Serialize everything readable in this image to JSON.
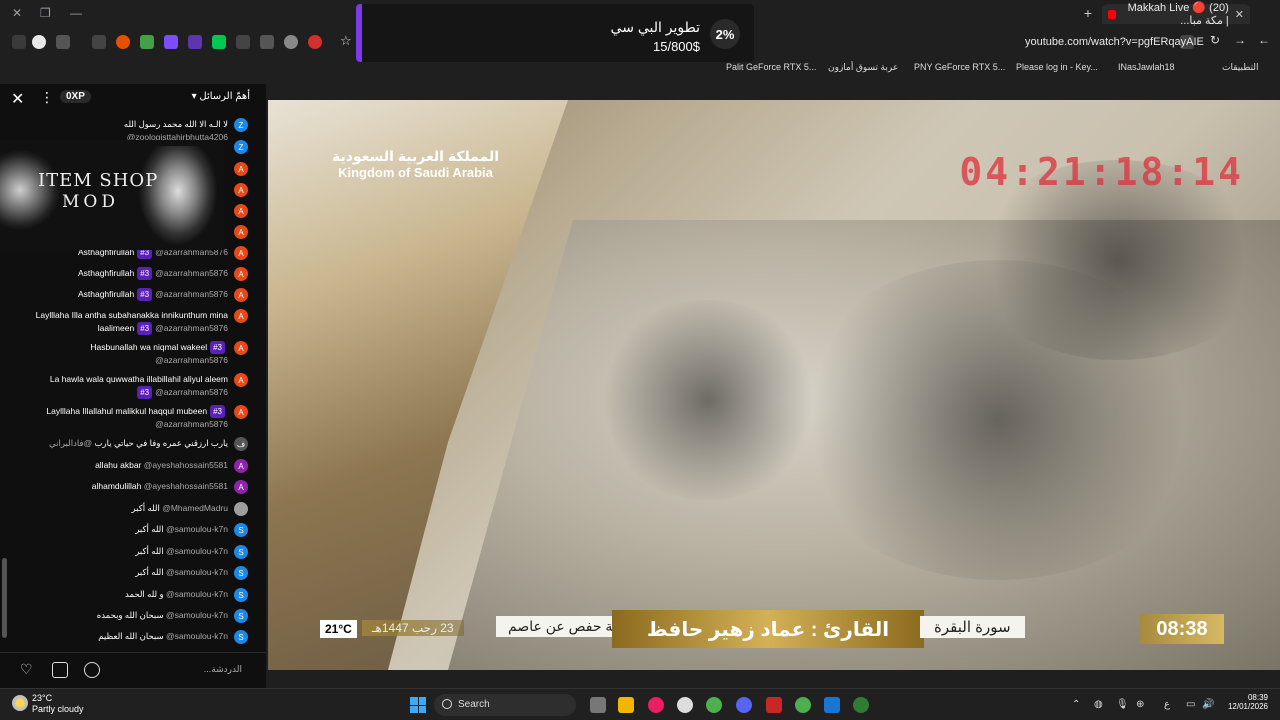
{
  "browser": {
    "tab_title": "(20) 🔴 Makkah Live | مكة مبا...",
    "url": "youtube.com/watch?v=pgfERqayAIE",
    "bookmarks": [
      "Palit GeForce RTX 5...",
      "عربة تسوق أمازون",
      "PNY GeForce RTX 5...",
      "Please log in - Key...",
      "INasJawlah18",
      "التطبيقات"
    ]
  },
  "notification": {
    "title": "تطوير البي سي",
    "progress_text": "15/800$",
    "percent": "2%"
  },
  "chat": {
    "sort_label": "أهمّ الرسائل",
    "xp_label": "0XP",
    "input_placeholder": "الدردشة...",
    "banner": {
      "title": "ITEM SHOP",
      "subtitle": "MOD"
    },
    "messages": [
      {
        "avatar": "Z",
        "color": "#1e88e5",
        "author": "@zoologisttahirbhutta4206",
        "text": "لا الـه الا الله محمد رسول الله"
      },
      {
        "avatar": "Z",
        "color": "#1e88e5",
        "author": "",
        "text": ""
      },
      {
        "avatar": "A",
        "color": "#e64a19",
        "author": "",
        "text": ""
      },
      {
        "avatar": "A",
        "color": "#e64a19",
        "author": "",
        "text": ""
      },
      {
        "avatar": "A",
        "color": "#e64a19",
        "author": "",
        "text": ""
      },
      {
        "avatar": "A",
        "color": "#e64a19",
        "author": "",
        "text": ""
      },
      {
        "avatar": "A",
        "color": "#e64a19",
        "author": "@azarrahman5876",
        "badge": "#3",
        "text": "Asthaghfirullah"
      },
      {
        "avatar": "A",
        "color": "#e64a19",
        "author": "@azarrahman5876",
        "badge": "#3",
        "text": "Asthaghfirullah"
      },
      {
        "avatar": "A",
        "color": "#e64a19",
        "author": "@azarrahman5876",
        "badge": "#3",
        "text": "Asthaghfirullah"
      },
      {
        "avatar": "A",
        "color": "#e64a19",
        "author": "@azarrahman5876",
        "badge": "#3",
        "text": "Laylllaha Illa antha subahanakka innikunthum mina laalimeen"
      },
      {
        "avatar": "A",
        "color": "#e64a19",
        "author": "@azarrahman5876",
        "badge": "#3",
        "text": "Hasbunallah wa niqmal wakeel"
      },
      {
        "avatar": "A",
        "color": "#e64a19",
        "author": "@azarrahman5876",
        "badge": "#3",
        "text": "La hawla wala quwwatha illabillahil aliyul aleem"
      },
      {
        "avatar": "A",
        "color": "#e64a19",
        "author": "@azarrahman5876",
        "badge": "#3",
        "text": "Laylllaha Illallahul malikkul haqqul mubeen"
      },
      {
        "avatar": "ف",
        "color": "#555555",
        "author": "@فادالبراني",
        "text": "يارب ارزقني عمره وفا في حياتي يارب"
      },
      {
        "avatar": "A",
        "color": "#8e24aa",
        "author": "@ayeshahossain5581",
        "text": "allahu akbar"
      },
      {
        "avatar": "A",
        "color": "#8e24aa",
        "author": "@ayeshahossain5581",
        "text": "alhamdulillah"
      },
      {
        "avatar": "",
        "color": "#9e9e9e",
        "author": "@MhamedMadru",
        "text": "الله أكبر"
      },
      {
        "avatar": "S",
        "color": "#1e88e5",
        "author": "@samoulou-k7n",
        "text": "الله أكبر"
      },
      {
        "avatar": "S",
        "color": "#1e88e5",
        "author": "@samoulou-k7n",
        "text": "الله أكبر"
      },
      {
        "avatar": "S",
        "color": "#1e88e5",
        "author": "@samoulou-k7n",
        "text": "الله أكبر"
      },
      {
        "avatar": "S",
        "color": "#1e88e5",
        "author": "@samoulou-k7n",
        "text": "و لله الحمد"
      },
      {
        "avatar": "S",
        "color": "#1e88e5",
        "author": "@samoulou-k7n",
        "text": "سبحان الله وبحمده"
      },
      {
        "avatar": "S",
        "color": "#1e88e5",
        "author": "@samoulou-k7n",
        "text": "سبحان الله العظيم"
      }
    ]
  },
  "video": {
    "logo_ar": "المملكة العربية السعودية",
    "logo_en": "Kingdom of Saudi Arabia",
    "countdown": "04:21:18:14",
    "temperature": "21°C",
    "hijri_date": "23 رجب 1447هـ",
    "riwaya": "رواية حفص عن عاصم",
    "qari": "القارئ : عماد زهير حافظ",
    "surah": "سورة البقرة",
    "time": "08:38"
  },
  "taskbar": {
    "weather_temp": "23°C",
    "weather_desc": "Partly cloudy",
    "search_label": "Search",
    "clock_time": "08:39",
    "clock_date": "12/01/2026",
    "lang": "ع"
  }
}
